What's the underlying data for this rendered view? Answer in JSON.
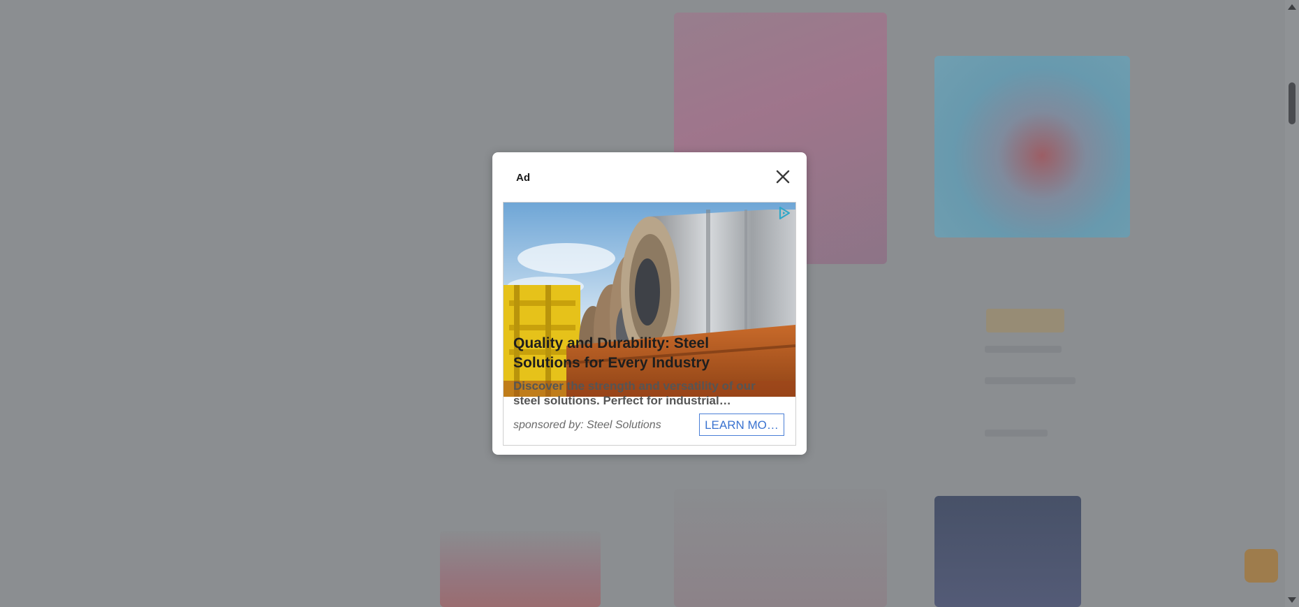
{
  "modal": {
    "title": "Ad",
    "close_icon": "close-icon"
  },
  "ad": {
    "choices_icon": "adchoices-icon",
    "headline": "Quality and Durability: Steel Solutions for Every Industry",
    "description": "Discover the strength and versatility of our steel solutions. Perfect for industrial…",
    "sponsor": "sponsored by: Steel Solutions",
    "cta_label": "LEARN MO…"
  },
  "colors": {
    "overlay": "#8b8e91",
    "cta": "#3a73d0",
    "choices": "#2fa7c8"
  }
}
